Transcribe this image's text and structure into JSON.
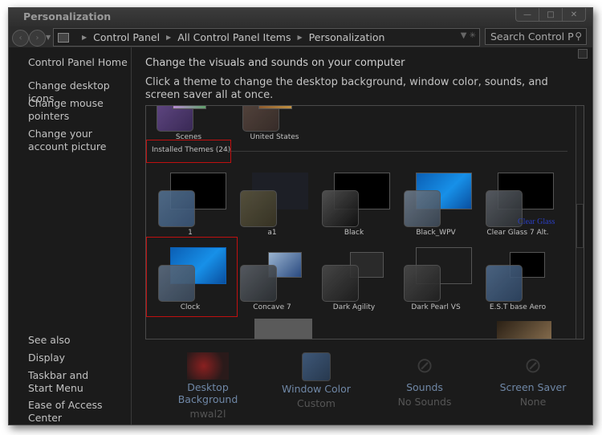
{
  "window": {
    "title": "Personalization",
    "controls": {
      "minimize": "minimize-icon",
      "maximize": "maximize-icon",
      "close": "close-icon"
    }
  },
  "nav": {
    "back_icon": "back-arrow-icon",
    "forward_icon": "forward-arrow-icon",
    "breadcrumb": [
      "Control Panel",
      "All Control Panel Items",
      "Personalization"
    ],
    "search_placeholder": "Search Control P"
  },
  "sidebar": {
    "home": "Control Panel Home",
    "links": [
      "Change desktop icons",
      "Change mouse pointers",
      "Change your account picture"
    ],
    "see_also_title": "See also",
    "see_also": [
      "Display",
      "Taskbar and Start Menu",
      "Ease of Access Center"
    ]
  },
  "main": {
    "heading": "Change the visuals and sounds on your computer",
    "subtext": "Click a theme to change the desktop background, window color, sounds, and screen saver all at once.",
    "top_themes": [
      "Scenes",
      "United States"
    ],
    "section_title": "Installed Themes (24)",
    "installed_themes": [
      "1",
      "a1",
      "Black",
      "Black_WPV",
      "Clear Glass 7 Alt.",
      "Clock",
      "Concave 7",
      "Dark Agility",
      "Dark Pearl VS",
      "E.S.T  base Aero"
    ],
    "clear_glass_overlay": "Clear Glass",
    "selected_theme": "Clock"
  },
  "bottom": [
    {
      "label": "Desktop Background",
      "value": "mwal2l"
    },
    {
      "label": "Window Color",
      "value": "Custom"
    },
    {
      "label": "Sounds",
      "value": "No Sounds"
    },
    {
      "label": "Screen Saver",
      "value": "None"
    }
  ],
  "colors": {
    "accent_link": "#6f87a6",
    "selection_red": "#c01010",
    "window_bg": "#1b1b1b"
  }
}
